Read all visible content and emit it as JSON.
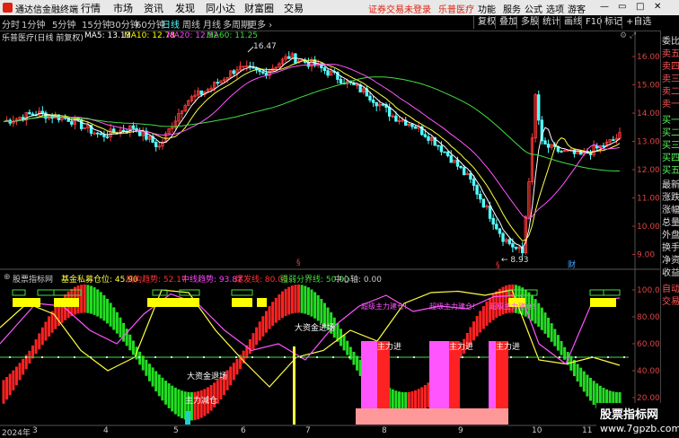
{
  "app": {
    "name": "通达信金融终端"
  },
  "menu": [
    "行情",
    "市场",
    "资讯",
    "发现",
    "同小达",
    "财富圈",
    "交易"
  ],
  "top_right": {
    "alert": "证券交易未登录",
    "stock": "乐普医疗",
    "links": [
      "功能",
      "服务",
      "公式",
      "选项",
      "游客"
    ]
  },
  "periods": [
    "分时",
    "1分钟",
    "5分钟",
    "15分钟",
    "30分钟",
    "60分钟",
    "日线",
    "周线",
    "月线",
    "多周期",
    "更多 ›"
  ],
  "active_period": "日线",
  "toolbar_right": [
    "复权",
    "叠加",
    "多股",
    "统计",
    "画线",
    "F10",
    "标记",
    "+自选"
  ],
  "sidebar": [
    "委比",
    "卖五",
    "卖四",
    "卖三",
    "卖二",
    "卖一",
    "买一",
    "买二",
    "买三",
    "买四",
    "买五",
    "最新",
    "涨跌",
    "涨幅",
    "总量",
    "外盘",
    "换手",
    "净资",
    "收益"
  ],
  "sidebar_bottom": [
    "自动",
    "交易"
  ],
  "main_chart": {
    "stock_label": "乐普医疗(日线 前复权)",
    "ma": [
      {
        "label": "MA5: 13.13",
        "color": "#ffffff"
      },
      {
        "label": "MA10: 12.78",
        "color": "#ffff00"
      },
      {
        "label": "MA20: 12.52",
        "color": "#ff44ff"
      },
      {
        "label": "MA60: 11.25",
        "color": "#44dd44"
      }
    ],
    "y_ticks": [
      "16.00",
      "15.00",
      "14.00",
      "13.00",
      "12.00",
      "11.00",
      "10.00",
      "9.00"
    ],
    "high_label": "16.47",
    "low_label": "8.93",
    "marker": "财"
  },
  "indicator": {
    "name": "股票指标网",
    "items": [
      {
        "label": "基金私募仓位: 45.90",
        "color": "#ffff44"
      },
      {
        "label": "机构趋势: 52.17",
        "color": "#ff3333"
      },
      {
        "label": "中线趋势: 93.87",
        "color": "#ff44ff"
      },
      {
        "label": "爆发线: 80.00",
        "color": "#ff3333"
      },
      {
        "label": "强弱分界线: 50.00",
        "color": "#44dd44"
      },
      {
        "label": "中心轴: 0.00",
        "color": "#cccccc"
      }
    ],
    "y_ticks": [
      "100.00",
      "80.00",
      "60.00",
      "40.00",
      "20.00"
    ],
    "annotations": [
      "大资金进场",
      "大资金退场",
      "主力减仓",
      "超级主力建仓!",
      "超级主力建仓!",
      "超级主力建仓!",
      "主力进",
      "主力进",
      "主力进"
    ]
  },
  "dates": [
    "2024年",
    "3",
    "4",
    "5",
    "6",
    "7",
    "8",
    "9",
    "10",
    "11"
  ],
  "watermark": {
    "title": "股票指标网",
    "url": "www.7gpzb.com"
  }
}
